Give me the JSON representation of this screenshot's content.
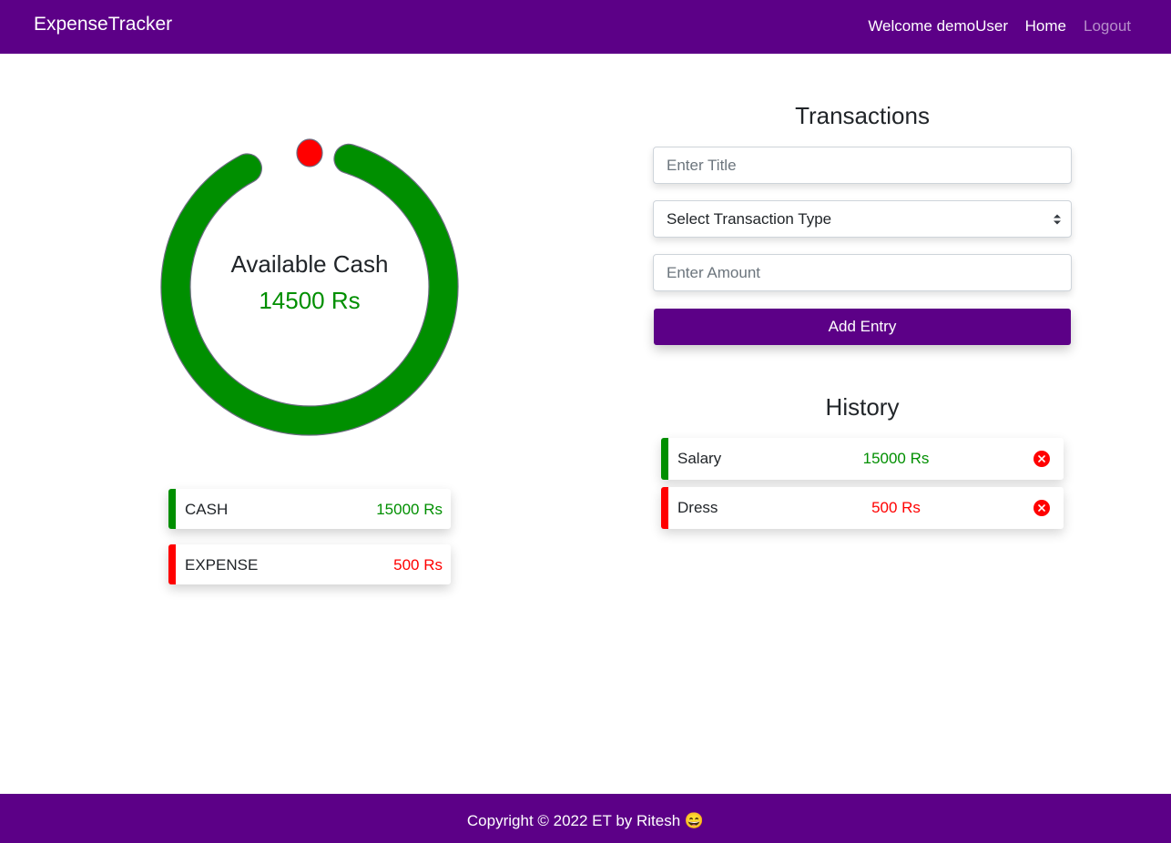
{
  "navbar": {
    "brand": "ExpenseTracker",
    "welcome": "Welcome demoUser",
    "home": "Home",
    "logout": "Logout"
  },
  "balance": {
    "label": "Available Cash",
    "amount": "14500 Rs",
    "ring": {
      "cash_value": 15000,
      "expense_value": 500,
      "cash_color": "#008f00",
      "expense_color": "#ff0000"
    }
  },
  "summary": [
    {
      "label": "CASH",
      "value": "15000 Rs",
      "color": "#008f00"
    },
    {
      "label": "EXPENSE",
      "value": "500 Rs",
      "color": "#ff0000"
    }
  ],
  "transactions": {
    "title": "Transactions",
    "title_placeholder": "Enter Title",
    "type_select": "Select Transaction Type",
    "amount_placeholder": "Enter Amount",
    "add_button": "Add Entry"
  },
  "history": {
    "title": "History",
    "items": [
      {
        "title": "Salary",
        "amount": "15000 Rs",
        "color": "#008f00",
        "delete_icon": "close-circle-icon"
      },
      {
        "title": "Dress",
        "amount": "500 Rs",
        "color": "#ff0000",
        "delete_icon": "close-circle-icon"
      }
    ]
  },
  "footer": {
    "text": "Copyright © 2022 ET by Ritesh 😄"
  },
  "colors": {
    "brand": "#5c0087",
    "income": "#008f00",
    "expense": "#ff0000"
  }
}
